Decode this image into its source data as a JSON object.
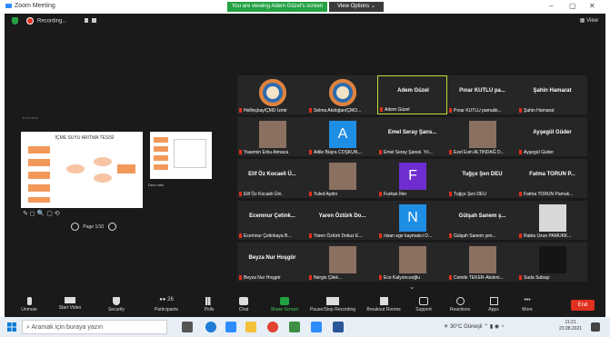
{
  "window": {
    "title": "Zoom Meeting",
    "min": "–",
    "max": "▢",
    "close": "✕"
  },
  "banner": {
    "viewing": "You are viewing Adem Güzel's screen",
    "view_options": "View Options ⌄"
  },
  "meeting": {
    "recording": "Recording...",
    "view_label": "View"
  },
  "shared": {
    "slide_title": "İÇME SUYU ARITMA TESİSİ",
    "page_label": "Page 1/10",
    "side_label": "Ders notu"
  },
  "participants": [
    {
      "name": "Hellinçkay/ÇMD İzmir",
      "type": "logo"
    },
    {
      "name": "Selma Akdoğan/ÇMO...",
      "type": "logo"
    },
    {
      "name": "Adem Güzel",
      "center": "Adem Güzel",
      "type": "text",
      "active": true
    },
    {
      "name": "Pınar KUTLU  pamukk...",
      "center": "Pınar KUTLU  pa...",
      "type": "text"
    },
    {
      "name": "Şahin Hamarat",
      "center": "Şahin Hamarat",
      "type": "text"
    },
    {
      "name": "Yasemin Erbu Atmaca",
      "type": "photo"
    },
    {
      "name": "Adile Büşra COŞKUN,...",
      "letter": "A",
      "type": "blue"
    },
    {
      "name": "Emel Seray Şansk. Yıl...",
      "center": "Emel Seray Şans...",
      "type": "text"
    },
    {
      "name": "Ezel Evin ALTINDAĞ D...",
      "type": "photo"
    },
    {
      "name": "Ayşegül Güder",
      "center": "Ayşegül Güder",
      "type": "text"
    },
    {
      "name": "Elif Öz Kocaeli Üni.",
      "center": "Elif Öz Kocaeli Ü...",
      "type": "text"
    },
    {
      "name": "Yuled Aydın",
      "type": "photo"
    },
    {
      "name": "Furkan İlter",
      "letter": "F",
      "type": "purple"
    },
    {
      "name": "Tuğçe Şen DEU",
      "center": "Tuğçe Şen DEU",
      "type": "text"
    },
    {
      "name": "Fatma TORUN Pamuk...",
      "center": "Fatma TORUN P...",
      "type": "text"
    },
    {
      "name": "Ecemnur Çetinkaya B...",
      "center": "Ecemnur Çetink...",
      "type": "text"
    },
    {
      "name": "Yaren Öztürk Dokuz E...",
      "center": "Yaren Öztürk Do...",
      "type": "text"
    },
    {
      "name": "nisan ege kaymakci D...",
      "letter": "N",
      "type": "blue"
    },
    {
      "name": "Gülşah Sanem şen...",
      "center": "Gülşah Sanem ş...",
      "type": "text"
    },
    {
      "name": "Rabia Uzun PAMUKK...",
      "type": "photo_light"
    },
    {
      "name": "Beyza Nur Hoşgör",
      "center": "Beyza Nur Hoşgör",
      "type": "text"
    },
    {
      "name": "Nergis Çileli...",
      "type": "photo"
    },
    {
      "name": "Ece Kalyoncuoğlu",
      "type": "photo"
    },
    {
      "name": "Cemile TEKER-Akdeni...",
      "type": "photo"
    },
    {
      "name": "Suda Subaşı",
      "type": "dark"
    }
  ],
  "toolbar": {
    "unmute": "Unmute",
    "start_video": "Start Video",
    "security": "Security",
    "participants": "Participants",
    "participants_count": "26",
    "polls": "Polls",
    "chat": "Chat",
    "share_screen": "Share Screen",
    "recording": "Pause/Stop Recording",
    "breakout": "Breakout Rooms",
    "support": "Support",
    "reactions": "Reactions",
    "apps": "Apps",
    "more": "More",
    "end": "End"
  },
  "taskbar": {
    "search_placeholder": "Aramak için buraya yazın",
    "weather": "30°C  Güneşli",
    "time": "11:21",
    "date": "23.08.2021"
  },
  "colors": {
    "accent": "#2d8cff",
    "green": "#23a243",
    "end": "#e0301e",
    "active_border": "#c7d93a"
  }
}
